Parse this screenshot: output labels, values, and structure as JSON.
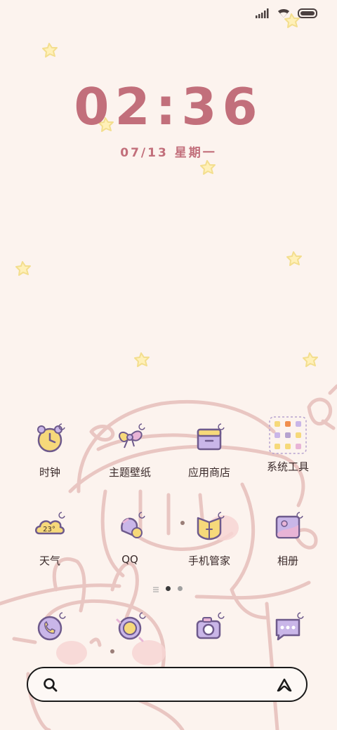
{
  "status_bar": {
    "icons": [
      "signal-icon",
      "wifi-icon",
      "battery-icon"
    ]
  },
  "lock": {
    "time": "02:36",
    "date": "07/13 星期一"
  },
  "apps": [
    {
      "label": "时钟",
      "icon": "clock-icon"
    },
    {
      "label": "主题壁纸",
      "icon": "theme-bow-icon"
    },
    {
      "label": "应用商店",
      "icon": "app-store-icon"
    },
    {
      "label": "系统工具",
      "icon": "folder-icon"
    },
    {
      "label": "天气",
      "icon": "weather-icon",
      "badge": "23°"
    },
    {
      "label": "QQ",
      "icon": "qq-icon"
    },
    {
      "label": "手机管家",
      "icon": "shield-icon"
    },
    {
      "label": "相册",
      "icon": "gallery-icon"
    }
  ],
  "dock": [
    "phone-icon",
    "browser-icon",
    "camera-icon",
    "messages-icon"
  ],
  "page_indicator": {
    "pages": 2,
    "active": 1
  },
  "search": {
    "placeholder": ""
  },
  "colors": {
    "background": "#FCF3EE",
    "clock": "#C26F7B",
    "icon_purple": "#C9B6E8",
    "icon_yellow": "#F6D97A",
    "outline": "#6E5A8C"
  }
}
